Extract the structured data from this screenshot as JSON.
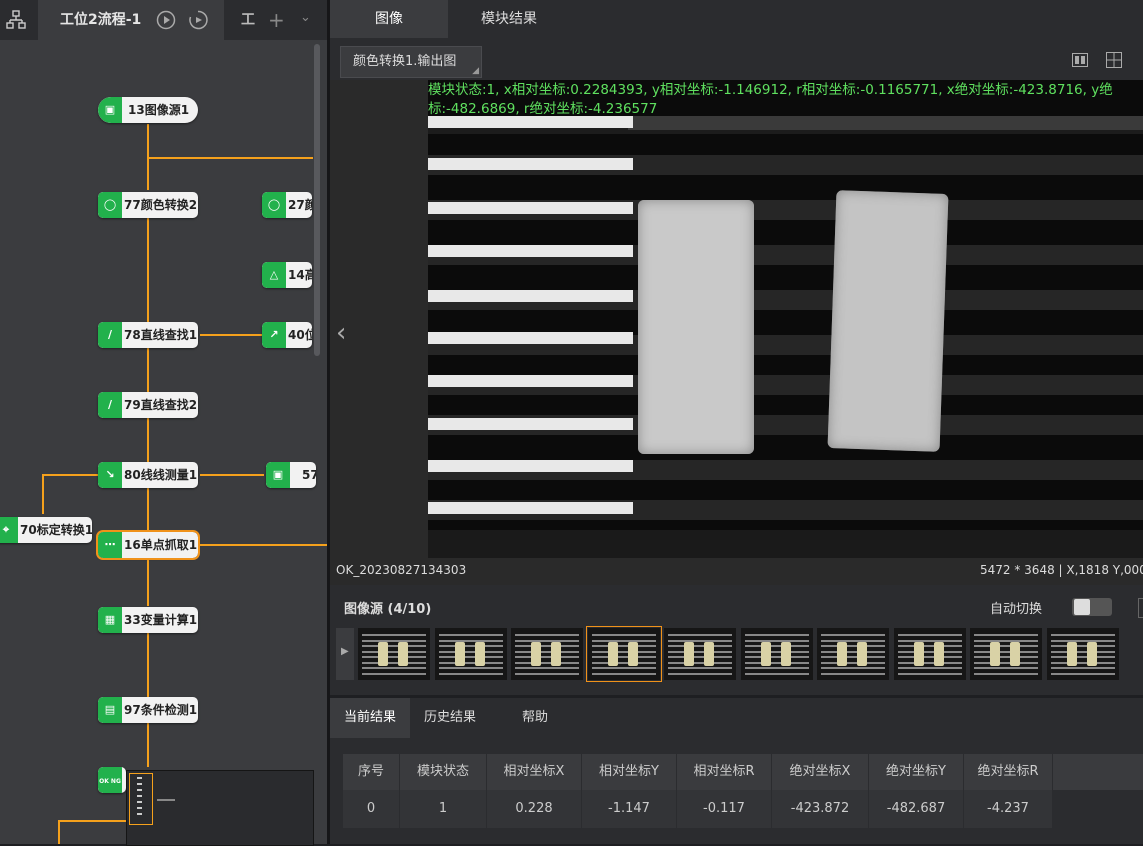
{
  "flow": {
    "tab_active": "工位2流程-1",
    "tab_next": "工",
    "nodes": [
      {
        "id": "n13",
        "label": "13图像源1",
        "icon": "image-icon"
      },
      {
        "id": "n77",
        "label": "77颜色转换2",
        "icon": "color-convert-icon"
      },
      {
        "id": "n27",
        "label": "27颜",
        "icon": "color-convert-icon"
      },
      {
        "id": "n14",
        "label": "14高",
        "icon": "filter-icon"
      },
      {
        "id": "n78",
        "label": "78直线查找1",
        "icon": "line-find-icon"
      },
      {
        "id": "n40",
        "label": "40位",
        "icon": "position-fix-icon"
      },
      {
        "id": "n79",
        "label": "79直线查找2",
        "icon": "line-find-icon"
      },
      {
        "id": "n80",
        "label": "80线线测量1",
        "icon": "measure-icon"
      },
      {
        "id": "n57",
        "label": "57",
        "icon": "image-icon"
      },
      {
        "id": "n70",
        "label": "70标定转换1",
        "icon": "calib-icon"
      },
      {
        "id": "n16",
        "label": "16单点抓取1",
        "icon": "point-grab-icon"
      },
      {
        "id": "n33",
        "label": "33变量计算1",
        "icon": "calculator-icon"
      },
      {
        "id": "n97",
        "label": "97条件检测1",
        "icon": "condition-icon"
      },
      {
        "id": "n_ok",
        "label": "OK NG",
        "icon": "ok-ng-icon"
      }
    ]
  },
  "tabs": {
    "image": "图像",
    "module_result": "模块结果"
  },
  "viewer": {
    "source_select": "颜色转换1.输出图",
    "overlay_line1": "模块状态:1, x相对坐标:0.2284393, y相对坐标:-1.146912, r相对坐标:-0.1165771, x绝对坐标:-423.8716, y绝",
    "overlay_line2": "标:-482.6869, r绝对坐标:-4.236577",
    "filename": "OK_20230827134303",
    "status": "5472 * 3648  |  X,1818  Y,000"
  },
  "thumbs": {
    "title": "图像源 (4/10)",
    "auto_switch_label": "自动切换",
    "count": 10,
    "selected_index": 3
  },
  "results": {
    "tab_current": "当前结果",
    "tab_history": "历史结果",
    "tab_help": "帮助",
    "columns": [
      "序号",
      "模块状态",
      "相对坐标X",
      "相对坐标Y",
      "相对坐标R",
      "绝对坐标X",
      "绝对坐标Y",
      "绝对坐标R"
    ],
    "rows": [
      [
        "0",
        "1",
        "0.228",
        "-1.147",
        "-0.117",
        "-423.872",
        "-482.687",
        "-4.237"
      ]
    ]
  },
  "colors": {
    "accent": "#f5a11c",
    "node_icon": "#22b14c",
    "overlay_text": "#5fe05f",
    "selected_border": "#f0921a"
  }
}
